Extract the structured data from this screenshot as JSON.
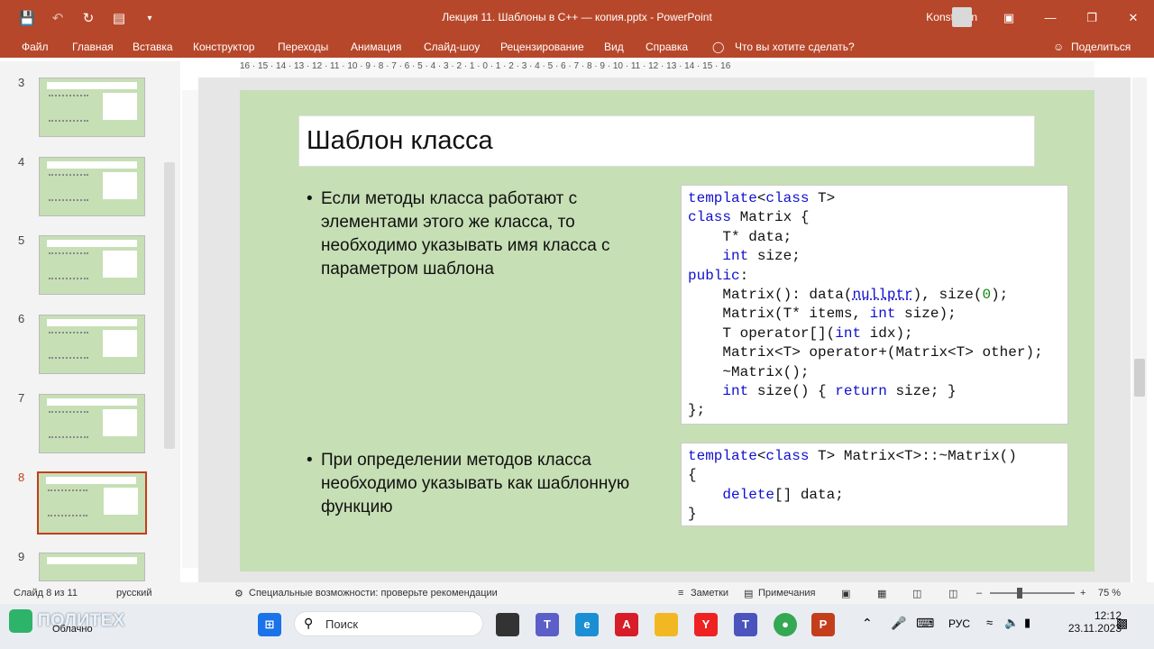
{
  "window": {
    "title": "Лекция 11. Шаблоны в С++ — копия.pptx - PowerPoint",
    "user": "Konstantin",
    "qat_icons": [
      "save-icon",
      "undo-icon",
      "redo-icon",
      "present-icon",
      "customize-icon"
    ]
  },
  "menu": {
    "items": [
      "Файл",
      "Главная",
      "Вставка",
      "Конструктор",
      "Переходы",
      "Анимация",
      "Слайд-шоу",
      "Рецензирование",
      "Вид",
      "Справка"
    ],
    "tell_me": "Что вы хотите сделать?",
    "share": "Поделиться"
  },
  "thumbnails": [
    {
      "num": "3",
      "active": false
    },
    {
      "num": "4",
      "active": false
    },
    {
      "num": "5",
      "active": false
    },
    {
      "num": "6",
      "active": false
    },
    {
      "num": "7",
      "active": false
    },
    {
      "num": "8",
      "active": true
    },
    {
      "num": "9",
      "active": false
    }
  ],
  "ruler": {
    "h": "16 · 15 · 14 · 13 · 12 · 11 · 10 · 9 · 8 · 7 · 6 · 5 · 4 · 3 · 2 · 1 · 0 · 1 · 2 · 3 · 4 · 5 · 6 · 7 · 8 · 9 · 10 · 11 · 12 · 13 · 14 · 15 · 16"
  },
  "slide": {
    "title": "Шаблон класса",
    "bullet1": "Если методы класса работают с элементами этого же класса, то необходимо указывать имя класса с параметром шаблона",
    "bullet2": "При определении методов класса необходимо указывать как шаблонную функцию",
    "code1": [
      "template<class T>",
      "class Matrix {",
      "    T* data;",
      "    int size;",
      "public:",
      "    Matrix(): data(nullptr), size(0);",
      "    Matrix(T* items, int size);",
      "    T operator[](int idx);",
      "    Matrix<T> operator+(Matrix<T> other);",
      "    ~Matrix();",
      "    int size() { return size; }",
      "};"
    ],
    "code2": [
      "template<class T> Matrix<T>::~Matrix()",
      "{",
      "    delete[] data;",
      "}"
    ]
  },
  "status": {
    "slide_info": "Слайд 8 из 11",
    "language": "русский",
    "accessibility": "Специальные возможности: проверьте рекомендации",
    "notes": "Заметки",
    "comments": "Примечания",
    "zoom": "75 %"
  },
  "taskbar": {
    "weather": "Облачно",
    "search": "Поиск",
    "lang": "РУС",
    "time": "12:12",
    "date": "23.11.2023",
    "logo_text": "ПОЛИТЕХ"
  }
}
